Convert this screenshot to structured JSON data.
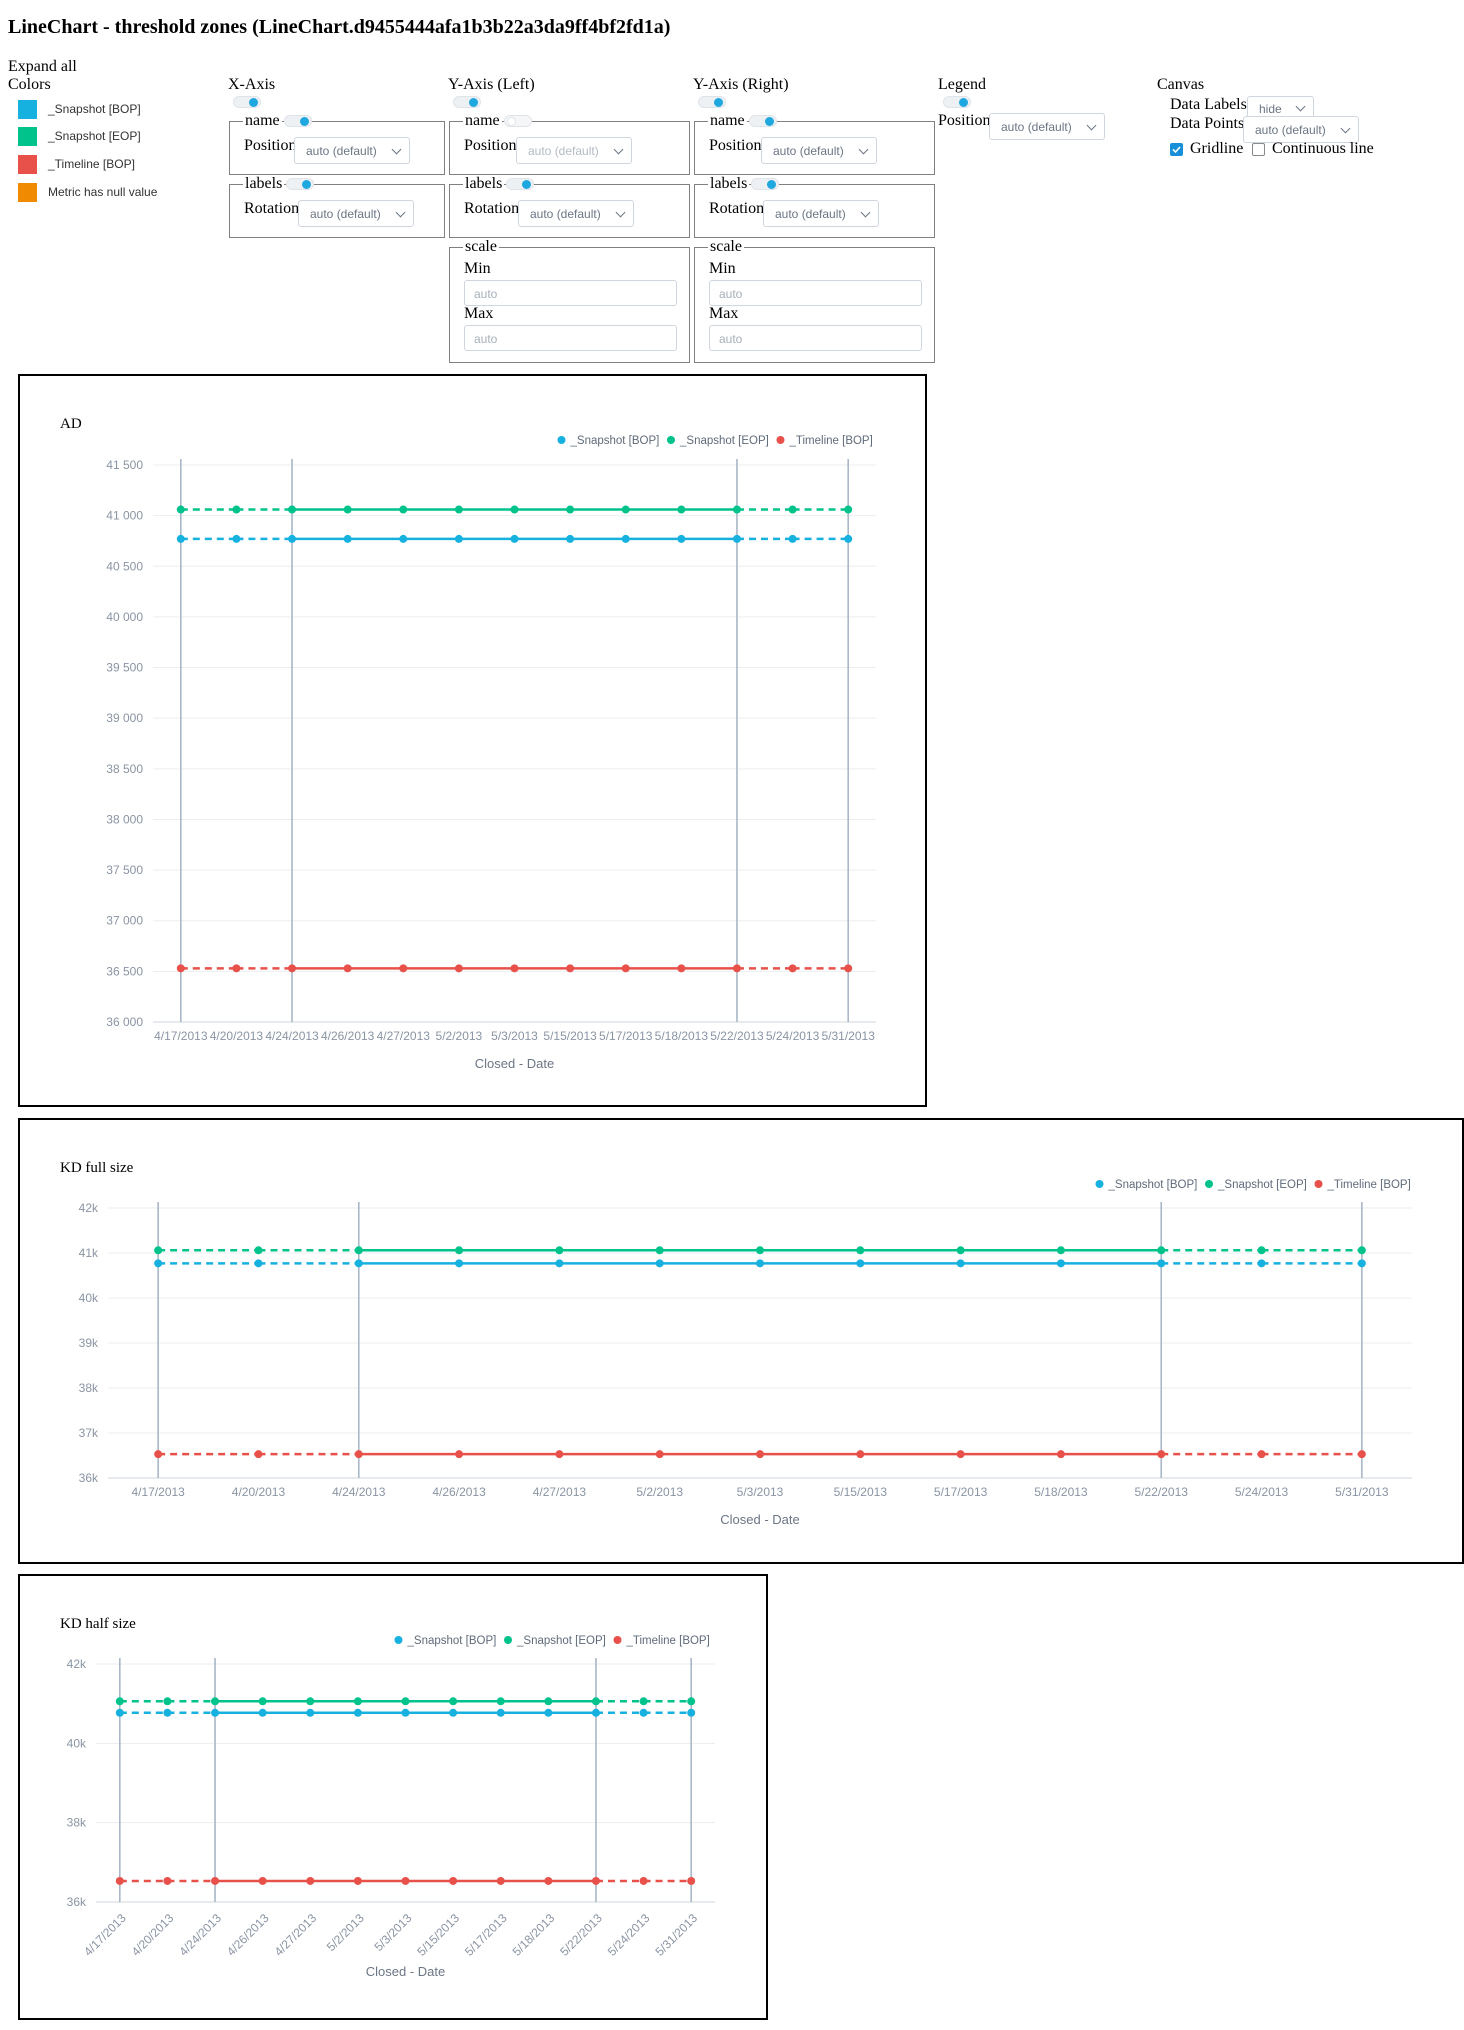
{
  "page": {
    "title": "LineChart - threshold zones (LineChart.d9455444afa1b3b22a3da9ff4bf2fd1a)"
  },
  "controls": {
    "expand_all": "Expand all",
    "colors_label": "Colors",
    "colors": [
      {
        "label": "_Snapshot [BOP]",
        "color": "#17b1e0"
      },
      {
        "label": "_Snapshot [EOP]",
        "color": "#00c28b"
      },
      {
        "label": "_Timeline [BOP]",
        "color": "#e8504a"
      },
      {
        "label": "Metric has null value",
        "color": "#f08a00"
      }
    ],
    "x_axis": {
      "title": "X-Axis",
      "toggle_on": true,
      "name": {
        "legend": "name",
        "toggle_on": true,
        "position_label": "Position",
        "position_value": "auto (default)"
      },
      "labels": {
        "legend": "labels",
        "toggle_on": true,
        "rotation_label": "Rotation",
        "rotation_value": "auto (default)"
      }
    },
    "y_axis_left": {
      "title": "Y-Axis (Left)",
      "toggle_on": true,
      "name": {
        "legend": "name",
        "toggle_on": false,
        "position_label": "Position",
        "position_value": "auto (default)"
      },
      "labels": {
        "legend": "labels",
        "toggle_on": true,
        "rotation_label": "Rotation",
        "rotation_value": "auto (default)"
      },
      "scale": {
        "legend": "scale",
        "min_label": "Min",
        "min_placeholder": "auto",
        "max_label": "Max",
        "max_placeholder": "auto"
      }
    },
    "y_axis_right": {
      "title": "Y-Axis (Right)",
      "toggle_on": true,
      "name": {
        "legend": "name",
        "toggle_on": true,
        "position_label": "Position",
        "position_value": "auto (default)"
      },
      "labels": {
        "legend": "labels",
        "toggle_on": true,
        "rotation_label": "Rotation",
        "rotation_value": "auto (default)"
      },
      "scale": {
        "legend": "scale",
        "min_label": "Min",
        "min_placeholder": "auto",
        "max_label": "Max",
        "max_placeholder": "auto"
      }
    },
    "legend": {
      "title": "Legend",
      "toggle_on": true,
      "position_label": "Position",
      "position_value": "auto (default)"
    },
    "canvas": {
      "title": "Canvas",
      "data_labels_label": "Data Labels",
      "data_labels_value": "hide",
      "data_points_label": "Data Points",
      "data_points_value": "auto (default)",
      "gridline_label": "Gridline",
      "gridline_checked": true,
      "continuous_label": "Continuous line",
      "continuous_checked": false
    }
  },
  "chart_data": [
    {
      "type": "line",
      "title": "AD",
      "xlabel": "Closed - Date",
      "ylabel": "",
      "ylim": [
        36000,
        41500
      ],
      "yticks": [
        36000,
        36500,
        37000,
        37500,
        38000,
        38500,
        39000,
        39500,
        40000,
        40500,
        41000,
        41500
      ],
      "ytick_labels": [
        "36 000",
        "36 500",
        "37 000",
        "37 500",
        "38 000",
        "38 500",
        "39 000",
        "39 500",
        "40 000",
        "40 500",
        "41 000",
        "41 500"
      ],
      "categories": [
        "4/17/2013",
        "4/20/2013",
        "4/24/2013",
        "4/26/2013",
        "4/27/2013",
        "5/2/2013",
        "5/3/2013",
        "5/15/2013",
        "5/17/2013",
        "5/18/2013",
        "5/22/2013",
        "5/24/2013",
        "5/31/2013"
      ],
      "threshold_lines": [
        "4/17/2013",
        "4/24/2013",
        "5/22/2013",
        "5/31/2013"
      ],
      "dashed_ranges": [
        [
          0,
          2
        ],
        [
          10,
          12
        ]
      ],
      "legend": "top-right",
      "grid": true,
      "xtick_rotation": 0,
      "series": [
        {
          "name": "_Snapshot [BOP]",
          "color": "#17b1e0",
          "values": [
            40770,
            40770,
            40770,
            40770,
            40770,
            40770,
            40770,
            40770,
            40770,
            40770,
            40770,
            40770,
            40770
          ]
        },
        {
          "name": "_Snapshot [EOP]",
          "color": "#00c28b",
          "values": [
            41060,
            41060,
            41060,
            41060,
            41060,
            41060,
            41060,
            41060,
            41060,
            41060,
            41060,
            41060,
            41060
          ]
        },
        {
          "name": "_Timeline [BOP]",
          "color": "#e8504a",
          "values": [
            36530,
            36530,
            36530,
            36530,
            36530,
            36530,
            36530,
            36530,
            36530,
            36530,
            36530,
            36530,
            36530
          ]
        }
      ]
    },
    {
      "type": "line",
      "title": "KD full size",
      "xlabel": "Closed - Date",
      "ylabel": "",
      "ylim": [
        36000,
        42000
      ],
      "yticks": [
        36000,
        37000,
        38000,
        39000,
        40000,
        41000,
        42000
      ],
      "ytick_labels": [
        "36k",
        "37k",
        "38k",
        "39k",
        "40k",
        "41k",
        "42k"
      ],
      "categories": [
        "4/17/2013",
        "4/20/2013",
        "4/24/2013",
        "4/26/2013",
        "4/27/2013",
        "5/2/2013",
        "5/3/2013",
        "5/15/2013",
        "5/17/2013",
        "5/18/2013",
        "5/22/2013",
        "5/24/2013",
        "5/31/2013"
      ],
      "threshold_lines": [
        "4/17/2013",
        "4/24/2013",
        "5/22/2013",
        "5/31/2013"
      ],
      "dashed_ranges": [
        [
          0,
          2
        ],
        [
          10,
          12
        ]
      ],
      "legend": "top-right",
      "grid": true,
      "xtick_rotation": 0,
      "series": [
        {
          "name": "_Snapshot [BOP]",
          "color": "#17b1e0",
          "values": [
            40770,
            40770,
            40770,
            40770,
            40770,
            40770,
            40770,
            40770,
            40770,
            40770,
            40770,
            40770,
            40770
          ]
        },
        {
          "name": "_Snapshot [EOP]",
          "color": "#00c28b",
          "values": [
            41060,
            41060,
            41060,
            41060,
            41060,
            41060,
            41060,
            41060,
            41060,
            41060,
            41060,
            41060,
            41060
          ]
        },
        {
          "name": "_Timeline [BOP]",
          "color": "#e8504a",
          "values": [
            36530,
            36530,
            36530,
            36530,
            36530,
            36530,
            36530,
            36530,
            36530,
            36530,
            36530,
            36530,
            36530
          ]
        }
      ]
    },
    {
      "type": "line",
      "title": "KD half size",
      "xlabel": "Closed - Date",
      "ylabel": "",
      "ylim": [
        36000,
        42000
      ],
      "yticks": [
        36000,
        38000,
        40000,
        42000
      ],
      "ytick_labels": [
        "36k",
        "38k",
        "40k",
        "42k"
      ],
      "categories": [
        "4/17/2013",
        "4/20/2013",
        "4/24/2013",
        "4/26/2013",
        "4/27/2013",
        "5/2/2013",
        "5/3/2013",
        "5/15/2013",
        "5/17/2013",
        "5/18/2013",
        "5/22/2013",
        "5/24/2013",
        "5/31/2013"
      ],
      "threshold_lines": [
        "4/17/2013",
        "4/24/2013",
        "5/22/2013",
        "5/31/2013"
      ],
      "dashed_ranges": [
        [
          0,
          2
        ],
        [
          10,
          12
        ]
      ],
      "legend": "top-right",
      "grid": true,
      "xtick_rotation": -45,
      "series": [
        {
          "name": "_Snapshot [BOP]",
          "color": "#17b1e0",
          "values": [
            40770,
            40770,
            40770,
            40770,
            40770,
            40770,
            40770,
            40770,
            40770,
            40770,
            40770,
            40770,
            40770
          ]
        },
        {
          "name": "_Snapshot [EOP]",
          "color": "#00c28b",
          "values": [
            41060,
            41060,
            41060,
            41060,
            41060,
            41060,
            41060,
            41060,
            41060,
            41060,
            41060,
            41060,
            41060
          ]
        },
        {
          "name": "_Timeline [BOP]",
          "color": "#e8504a",
          "values": [
            36530,
            36530,
            36530,
            36530,
            36530,
            36530,
            36530,
            36530,
            36530,
            36530,
            36530,
            36530,
            36530
          ]
        }
      ]
    }
  ]
}
